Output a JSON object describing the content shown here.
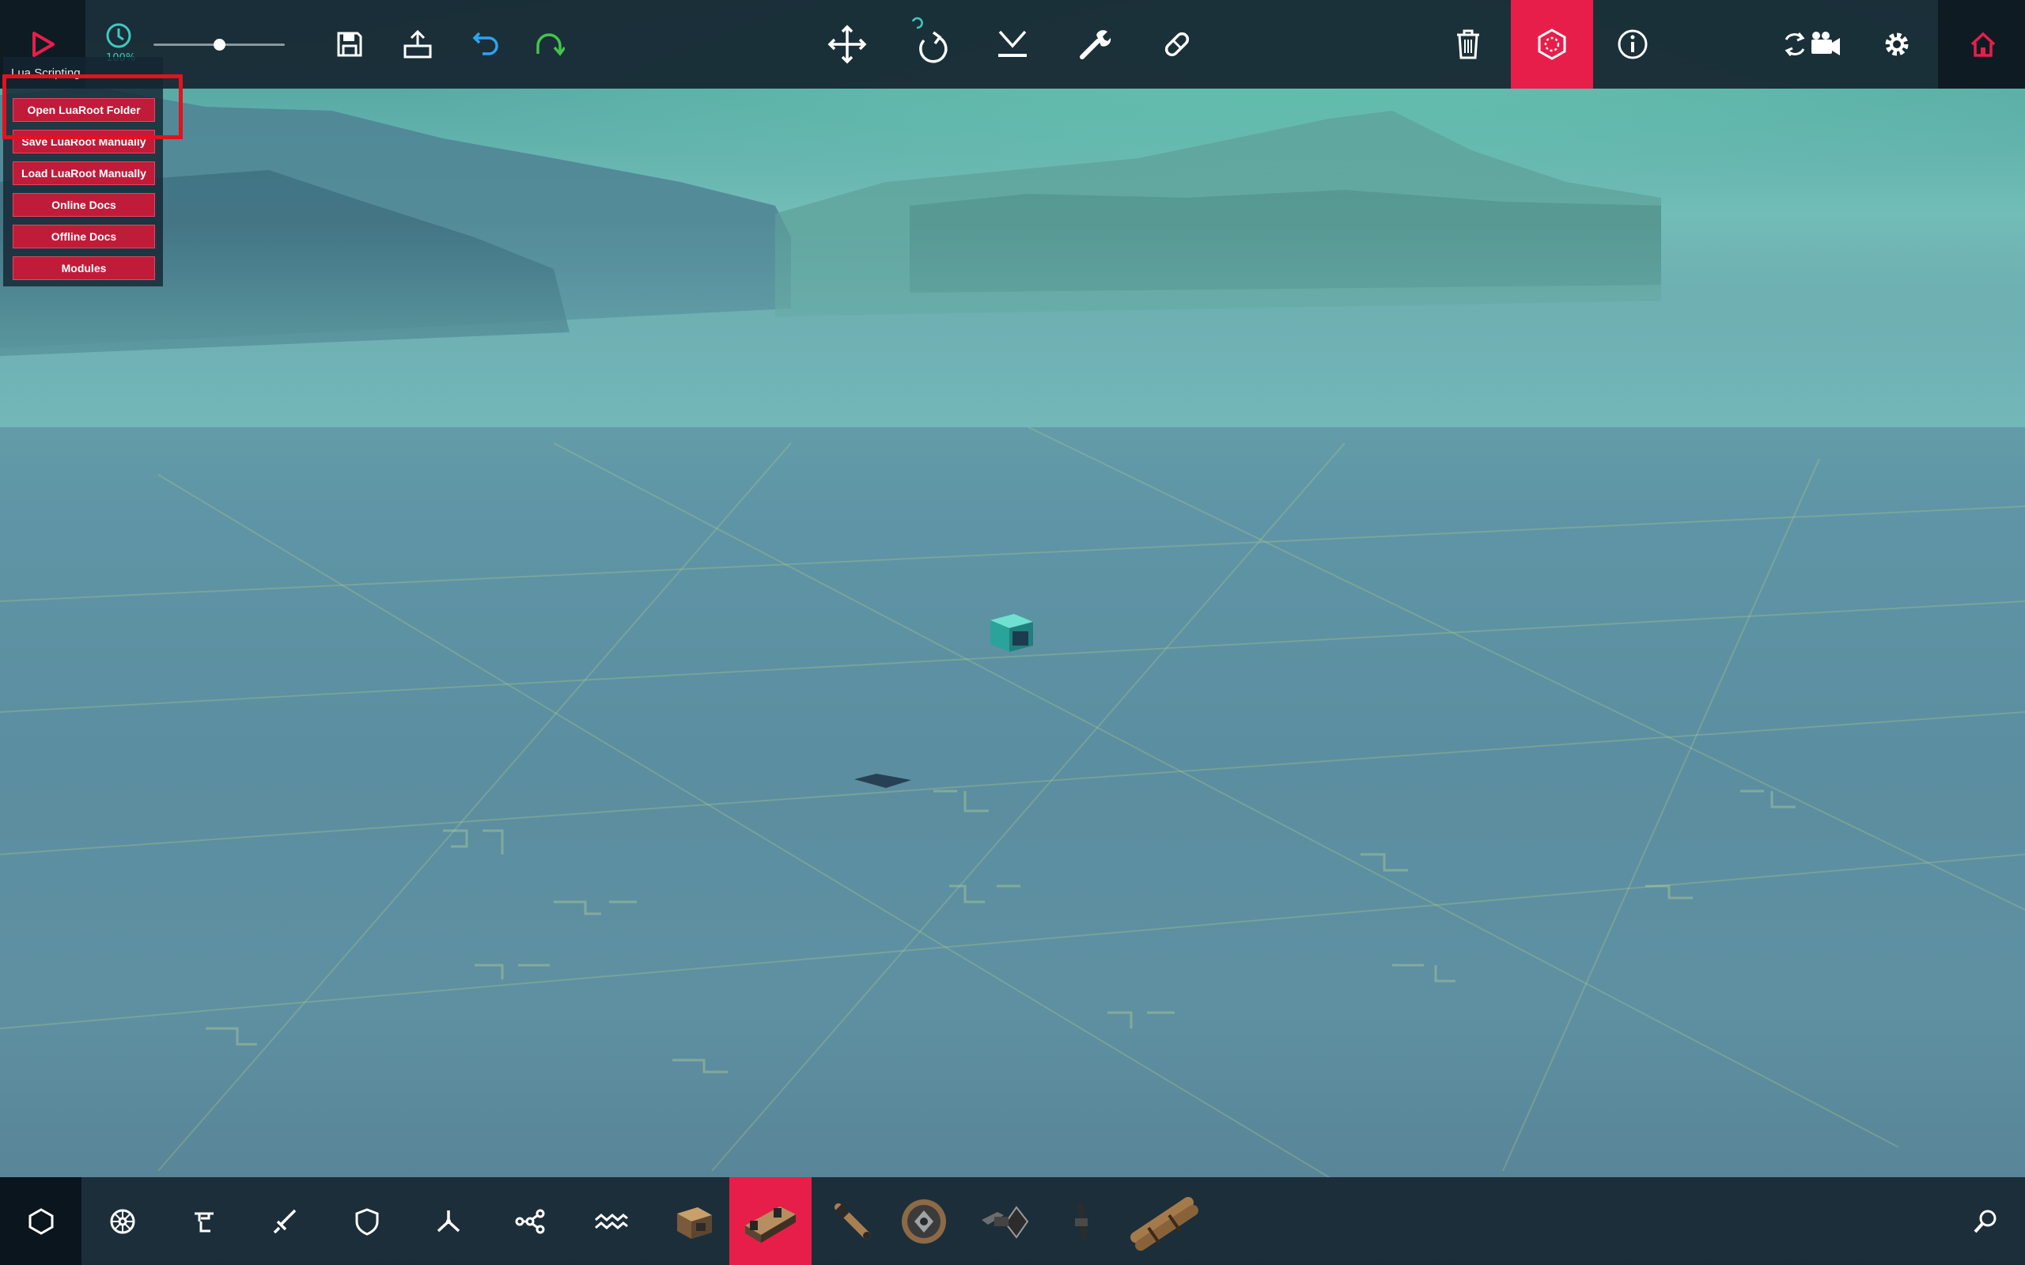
{
  "toolbar": {
    "play_icon": "play-icon",
    "speed_label": "100%",
    "speed_value": 0.5,
    "left_tools": [
      "save-icon",
      "upload-icon",
      "undo-icon",
      "redo-icon"
    ],
    "center_tools": [
      "move-icon",
      "rotate-icon",
      "drop-icon",
      "wrench-icon",
      "bandage-icon"
    ],
    "right_tools": [
      "trash-icon",
      "settings-hex-icon",
      "info-icon"
    ],
    "far_right_tools": [
      "camera-sync-icon",
      "gear-icon",
      "home-icon"
    ],
    "active_tool": "settings-hex-icon",
    "accent_color": "#e81e4a"
  },
  "lua_panel": {
    "title": "Lua Scripting",
    "buttons": [
      {
        "label": "Open LuaRoot Folder"
      },
      {
        "label": "Save LuaRoot Manually"
      },
      {
        "label": "Load LuaRoot Manually"
      },
      {
        "label": "Online Docs"
      },
      {
        "label": "Offline Docs"
      },
      {
        "label": "Modules"
      }
    ],
    "highlighted_button": "Open LuaRoot Folder"
  },
  "bottom_bar": {
    "categories": [
      "hexagon-icon",
      "steering-wheel-icon",
      "crane-icon",
      "sword-icon",
      "shield-icon",
      "propeller-icon",
      "network-icon",
      "waves-icon"
    ],
    "parts": [
      "wooden-block-part",
      "brace-part",
      "cannon-part",
      "wheel-part",
      "grabber-part",
      "spike-part",
      "log-bundle-part"
    ],
    "selected_part": "brace-part",
    "search_icon": "search-icon"
  }
}
